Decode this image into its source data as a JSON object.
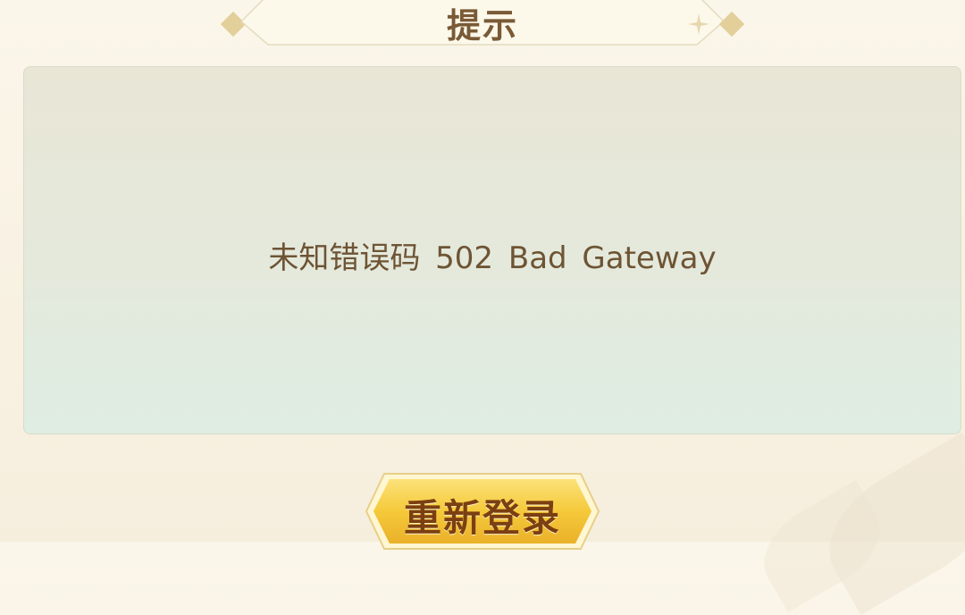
{
  "dialog": {
    "title": "提示",
    "message": "未知错误码 502 Bad Gateway",
    "relogin_label": "重新登录"
  },
  "colors": {
    "title_text": "#7a5a36",
    "message_text": "#6e5434",
    "button_fill": "#f5c93a",
    "button_text": "#7b3f12"
  }
}
